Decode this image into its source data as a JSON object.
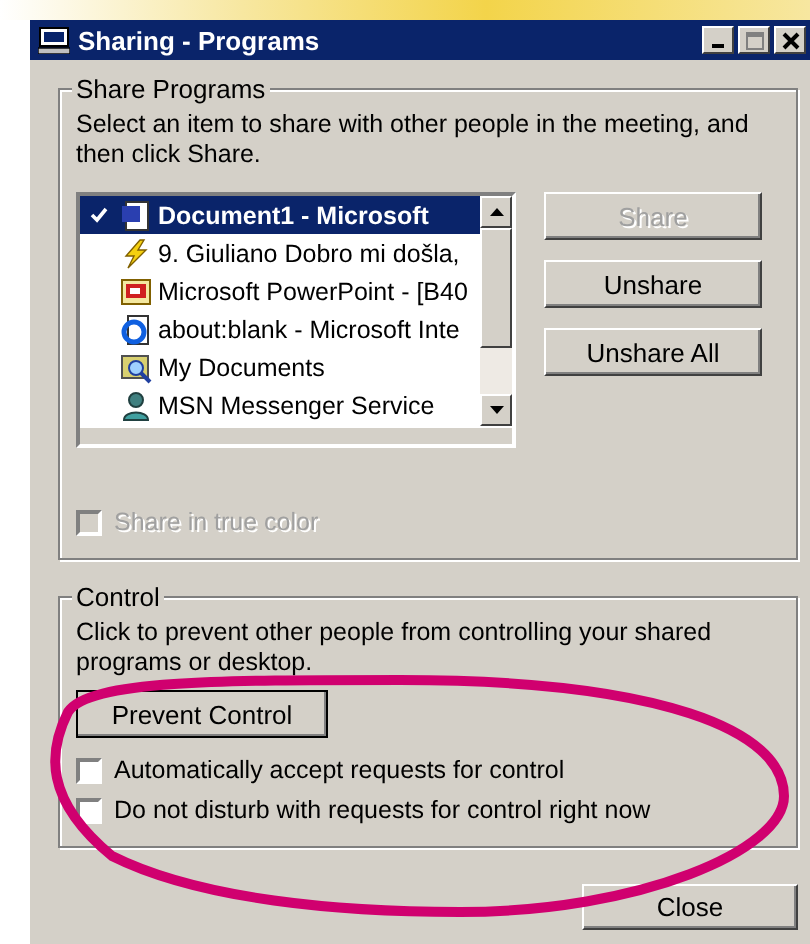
{
  "window": {
    "title": "Sharing - Programs"
  },
  "share_programs": {
    "title": "Share Programs",
    "instructions": "Select an item to share with other people in the meeting, and then click Share.",
    "items": [
      {
        "label": "Document1 - Microsoft",
        "selected": true,
        "checked": true
      },
      {
        "label": "9. Giuliano Dobro mi došla,",
        "selected": false,
        "checked": false
      },
      {
        "label": "Microsoft PowerPoint - [B40",
        "selected": false,
        "checked": false
      },
      {
        "label": "about:blank - Microsoft Inte",
        "selected": false,
        "checked": false
      },
      {
        "label": "My Documents",
        "selected": false,
        "checked": false
      },
      {
        "label": "MSN Messenger Service",
        "selected": false,
        "checked": false
      }
    ],
    "buttons": [
      {
        "label": "Share",
        "disabled": true
      },
      {
        "label": "Unshare",
        "disabled": false
      },
      {
        "label": "Unshare All",
        "disabled": false
      }
    ],
    "true_color": {
      "label": "Share in true color",
      "checked": false,
      "disabled": true
    }
  },
  "control": {
    "title": "Control",
    "description": "Click to prevent other people from controlling your shared programs or desktop.",
    "button": {
      "label": "Prevent Control"
    },
    "options": [
      {
        "label": "Automatically accept requests for control",
        "checked": false
      },
      {
        "label": "Do not disturb with requests for control right now",
        "checked": false
      }
    ]
  },
  "buttons": [
    {
      "label": "Close"
    }
  ]
}
